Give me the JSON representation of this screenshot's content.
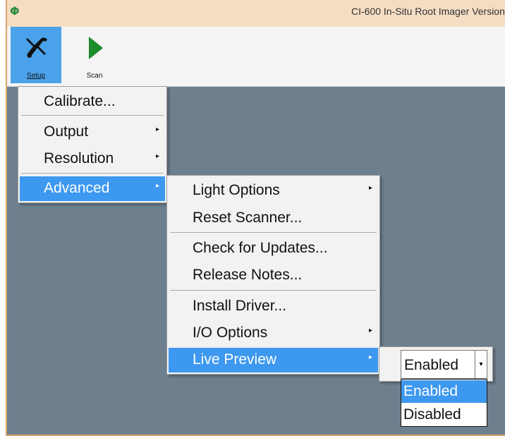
{
  "window": {
    "title": "CI-600 In-Situ Root Imager Version",
    "logo_glyph": "Φ",
    "colors": {
      "accent": "#3d98f0",
      "frame": "#dba56a",
      "background": "#6e7f8e"
    }
  },
  "ribbon": {
    "setup_label": "Setup",
    "scan_label": "Scan",
    "setup_icon": "tools-icon",
    "scan_icon": "play-icon"
  },
  "setup_menu": {
    "items": [
      {
        "label": "Calibrate...",
        "submenu": false
      },
      {
        "label": "Output",
        "submenu": true
      },
      {
        "label": "Resolution",
        "submenu": true
      },
      {
        "label": "Advanced",
        "submenu": true,
        "highlighted": true
      }
    ]
  },
  "advanced_menu": {
    "items": [
      {
        "label": "Light Options",
        "submenu": true
      },
      {
        "label": "Reset Scanner...",
        "submenu": false
      },
      {
        "label": "Check for Updates...",
        "submenu": false
      },
      {
        "label": "Release Notes...",
        "submenu": false
      },
      {
        "label": "Install Driver...",
        "submenu": false
      },
      {
        "label": "I/O Options",
        "submenu": true
      },
      {
        "label": "Live Preview",
        "submenu": true,
        "highlighted": true
      }
    ]
  },
  "live_preview": {
    "current_value": "Enabled",
    "options": [
      "Enabled",
      "Disabled"
    ],
    "selected_index": 0
  },
  "glyphs": {
    "submenu_arrow": "▸",
    "dropdown_arrow": "▾"
  }
}
